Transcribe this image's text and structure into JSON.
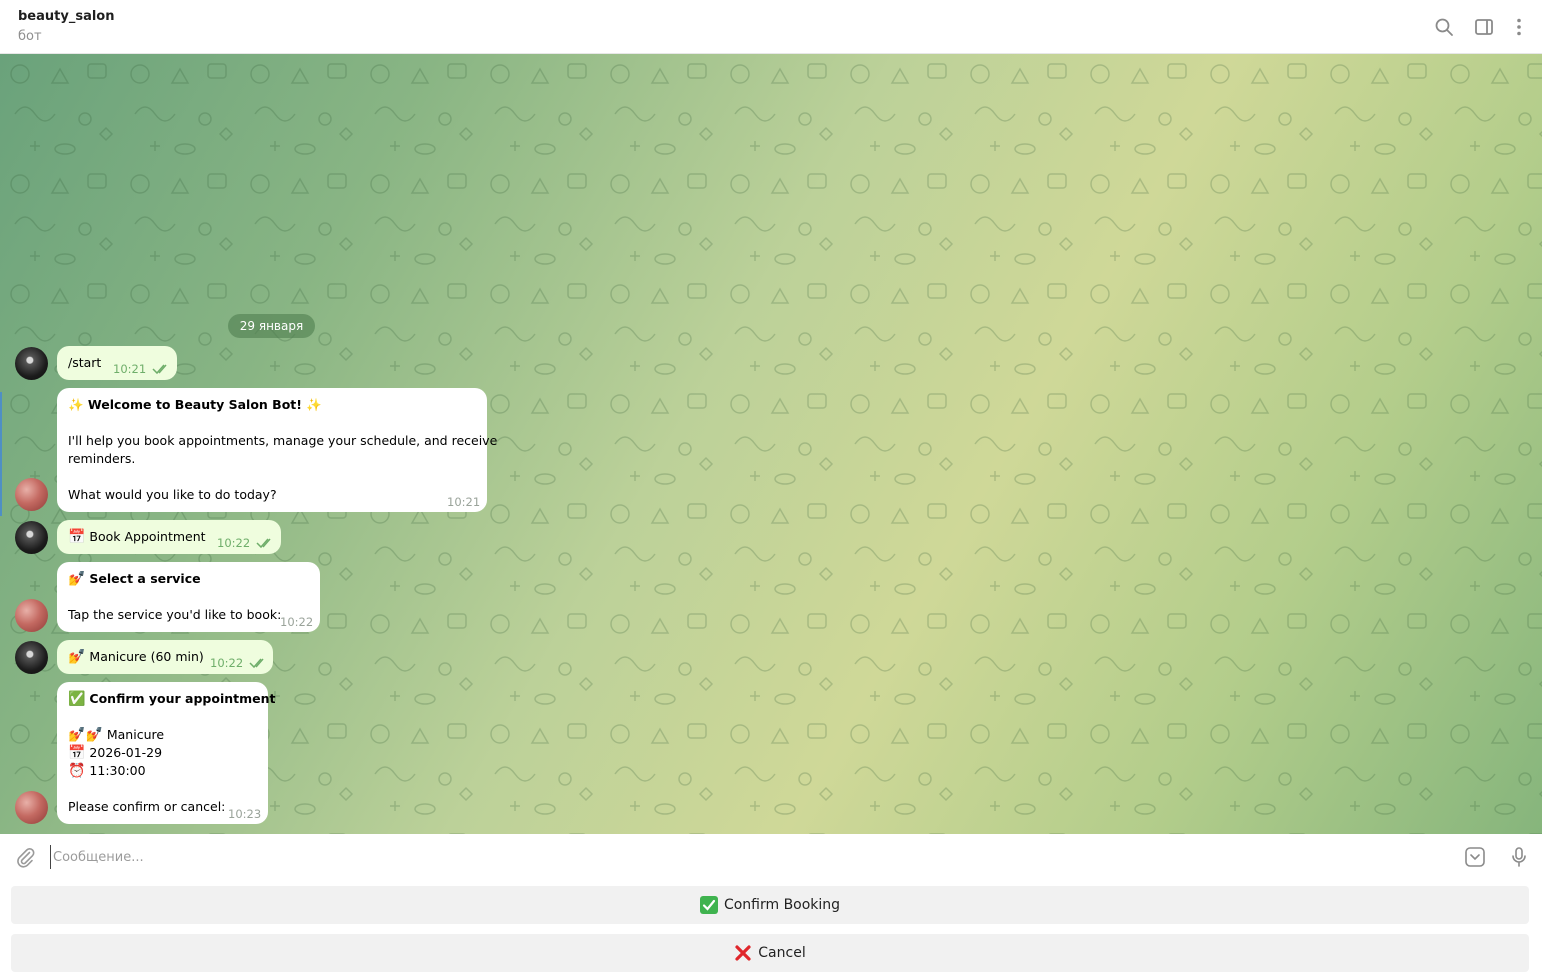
{
  "header": {
    "title": "beauty_salon",
    "subtitle": "бот",
    "icons": [
      "search-icon",
      "sidebar-toggle-icon",
      "more-vertical-icon"
    ]
  },
  "chat": {
    "date": "29 января",
    "messages": [
      {
        "from": "user",
        "text": "/start",
        "time": "10:21",
        "read": true
      },
      {
        "from": "bot",
        "lines": [
          "✨ Welcome to Beauty Salon Bot! ✨",
          "",
          "I'll help you book appointments, manage your schedule, and receive",
          "reminders.",
          "",
          "What would you like to do today?"
        ],
        "time": "10:21"
      },
      {
        "from": "user",
        "icon": "calendar-icon",
        "text": "Book Appointment",
        "time": "10:22",
        "read": true
      },
      {
        "from": "bot",
        "icon": "nail-polish-icon",
        "title": "Select a service",
        "body": "Tap the service you'd like to book:",
        "time": "10:22"
      },
      {
        "from": "user",
        "icon": "nail-polish-icon",
        "text": "Manicure (60 min)",
        "time": "10:22",
        "read": true
      },
      {
        "from": "bot",
        "icon": "check-mark-icon",
        "title": "Confirm your appointment",
        "service": "Manicure",
        "date": "2026-01-29",
        "clock": "11:30:00",
        "footer": "Please confirm or cancel:",
        "time": "10:23"
      }
    ]
  },
  "composer": {
    "placeholder": "Сообщение...",
    "icons": [
      "paperclip-icon",
      "keyboard-toggle-icon",
      "microphone-icon"
    ]
  },
  "keyboard": {
    "confirm_label": "Confirm Booking",
    "cancel_label": "Cancel"
  },
  "colors": {
    "outgoing_bubble": "#effdde",
    "incoming_bubble": "#ffffff",
    "read_check": "#6fae6a",
    "command_link": "#3b8dd1"
  }
}
